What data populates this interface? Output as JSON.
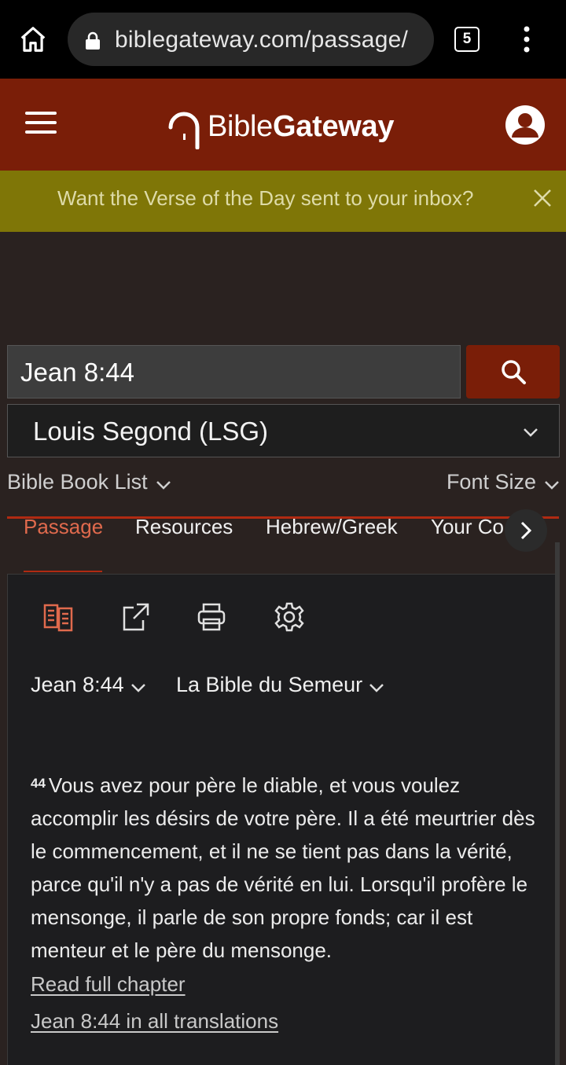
{
  "browser": {
    "url": "biblegateway.com/passage/",
    "tab_count": "5"
  },
  "header": {
    "logo_light": "Bible",
    "logo_bold": "Gateway"
  },
  "banner": {
    "text": "Want the Verse of the Day sent to your inbox?"
  },
  "search": {
    "query": "Jean 8:44",
    "version": "Louis Segond (LSG)"
  },
  "controls": {
    "book_list": "Bible Book List",
    "font_size": "Font Size"
  },
  "tabs": [
    {
      "label": "Passage",
      "active": true
    },
    {
      "label": "Resources"
    },
    {
      "label": "Hebrew/Greek"
    },
    {
      "label": "Your Co"
    }
  ],
  "passage": {
    "reference": "Jean 8:44",
    "compare_version": "La Bible du Semeur",
    "verse_number": "44",
    "verse_text": "Vous avez pour père le diable, et vous voulez accomplir les désirs de votre père. Il a été meurtrier dès le commencement, et il ne se tient pas dans la vérité, parce qu'il n'y a pas de vérité en lui. Lorsqu'il profère le mensonge, il parle de son propre fonds; car il est menteur et le père du mensonge.",
    "read_full_chapter": "Read full chapter",
    "all_translations": "Jean 8:44 in all translations"
  },
  "colors": {
    "brand": "#7a1e08",
    "banner": "#7f7607",
    "accent": "#e06a4d"
  }
}
